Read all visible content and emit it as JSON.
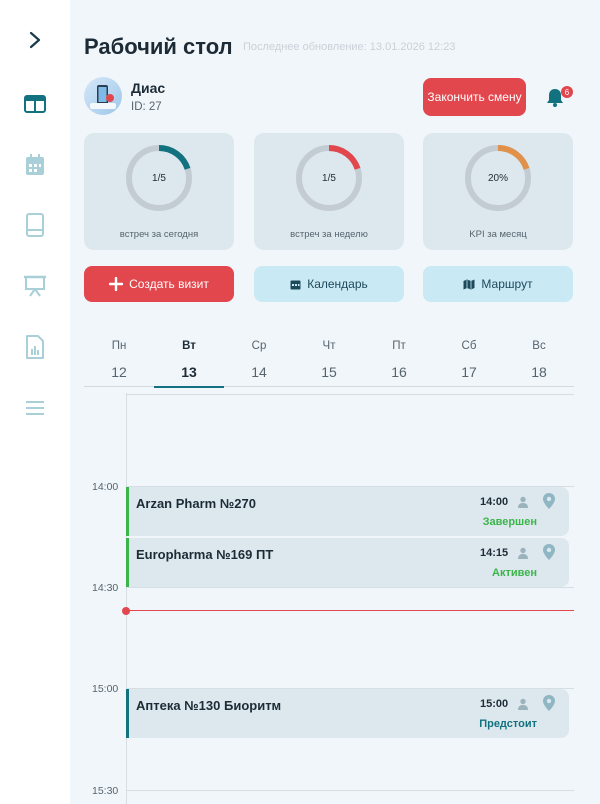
{
  "app": {
    "title": "Рабочий стол",
    "last_update": "Последнее обновление: 13.01.2026 12:23"
  },
  "user": {
    "name": "Диас",
    "id": "ID: 27"
  },
  "header": {
    "end_shift_label": "Закончить смену",
    "notifications_count": "6"
  },
  "stats": [
    {
      "value": "1/5",
      "label": "встреч за сегодня",
      "fraction": 0.2,
      "color": "#137280"
    },
    {
      "value": "1/5",
      "label": "встреч за неделю",
      "fraction": 0.2,
      "color": "#e1474d"
    },
    {
      "value": "20%",
      "label": "KPI за месяц",
      "fraction": 0.2,
      "color": "#e0914a"
    }
  ],
  "actions": {
    "create_visit": "Создать визит",
    "calendar": "Календарь",
    "route": "Маршрут"
  },
  "week": [
    {
      "name": "Пн",
      "num": "12"
    },
    {
      "name": "Вт",
      "num": "13",
      "active": true
    },
    {
      "name": "Ср",
      "num": "14"
    },
    {
      "name": "Чт",
      "num": "15"
    },
    {
      "name": "Пт",
      "num": "16"
    },
    {
      "name": "Сб",
      "num": "17"
    },
    {
      "name": "Вс",
      "num": "18"
    }
  ],
  "timeline": {
    "times": [
      "14:00",
      "14:30",
      "15:00",
      "15:30"
    ]
  },
  "visits": [
    {
      "name": "Arzan Pharm №270",
      "time": "14:00",
      "status": "Завершен",
      "status_color": "#3bb54a",
      "bar_color": "#3bb54a"
    },
    {
      "name": "Europharma №169 ПТ",
      "time": "14:15",
      "status": "Активен",
      "status_color": "#3bb54a",
      "bar_color": "#3bb54a"
    },
    {
      "name": "Аптека №130 Биоритм",
      "time": "15:00",
      "status": "Предстоит",
      "status_color": "#137280",
      "bar_color": "#137280"
    }
  ],
  "colors": {
    "accent": "#137280",
    "danger": "#e1474d",
    "success": "#3bb54a",
    "light_accent": "#c9e9f5"
  },
  "icons": {
    "sidebar": [
      "chevron-right-icon",
      "dashboard-icon",
      "calendar-icon",
      "book-icon",
      "presentation-icon",
      "report-icon",
      "menu-icon"
    ]
  }
}
